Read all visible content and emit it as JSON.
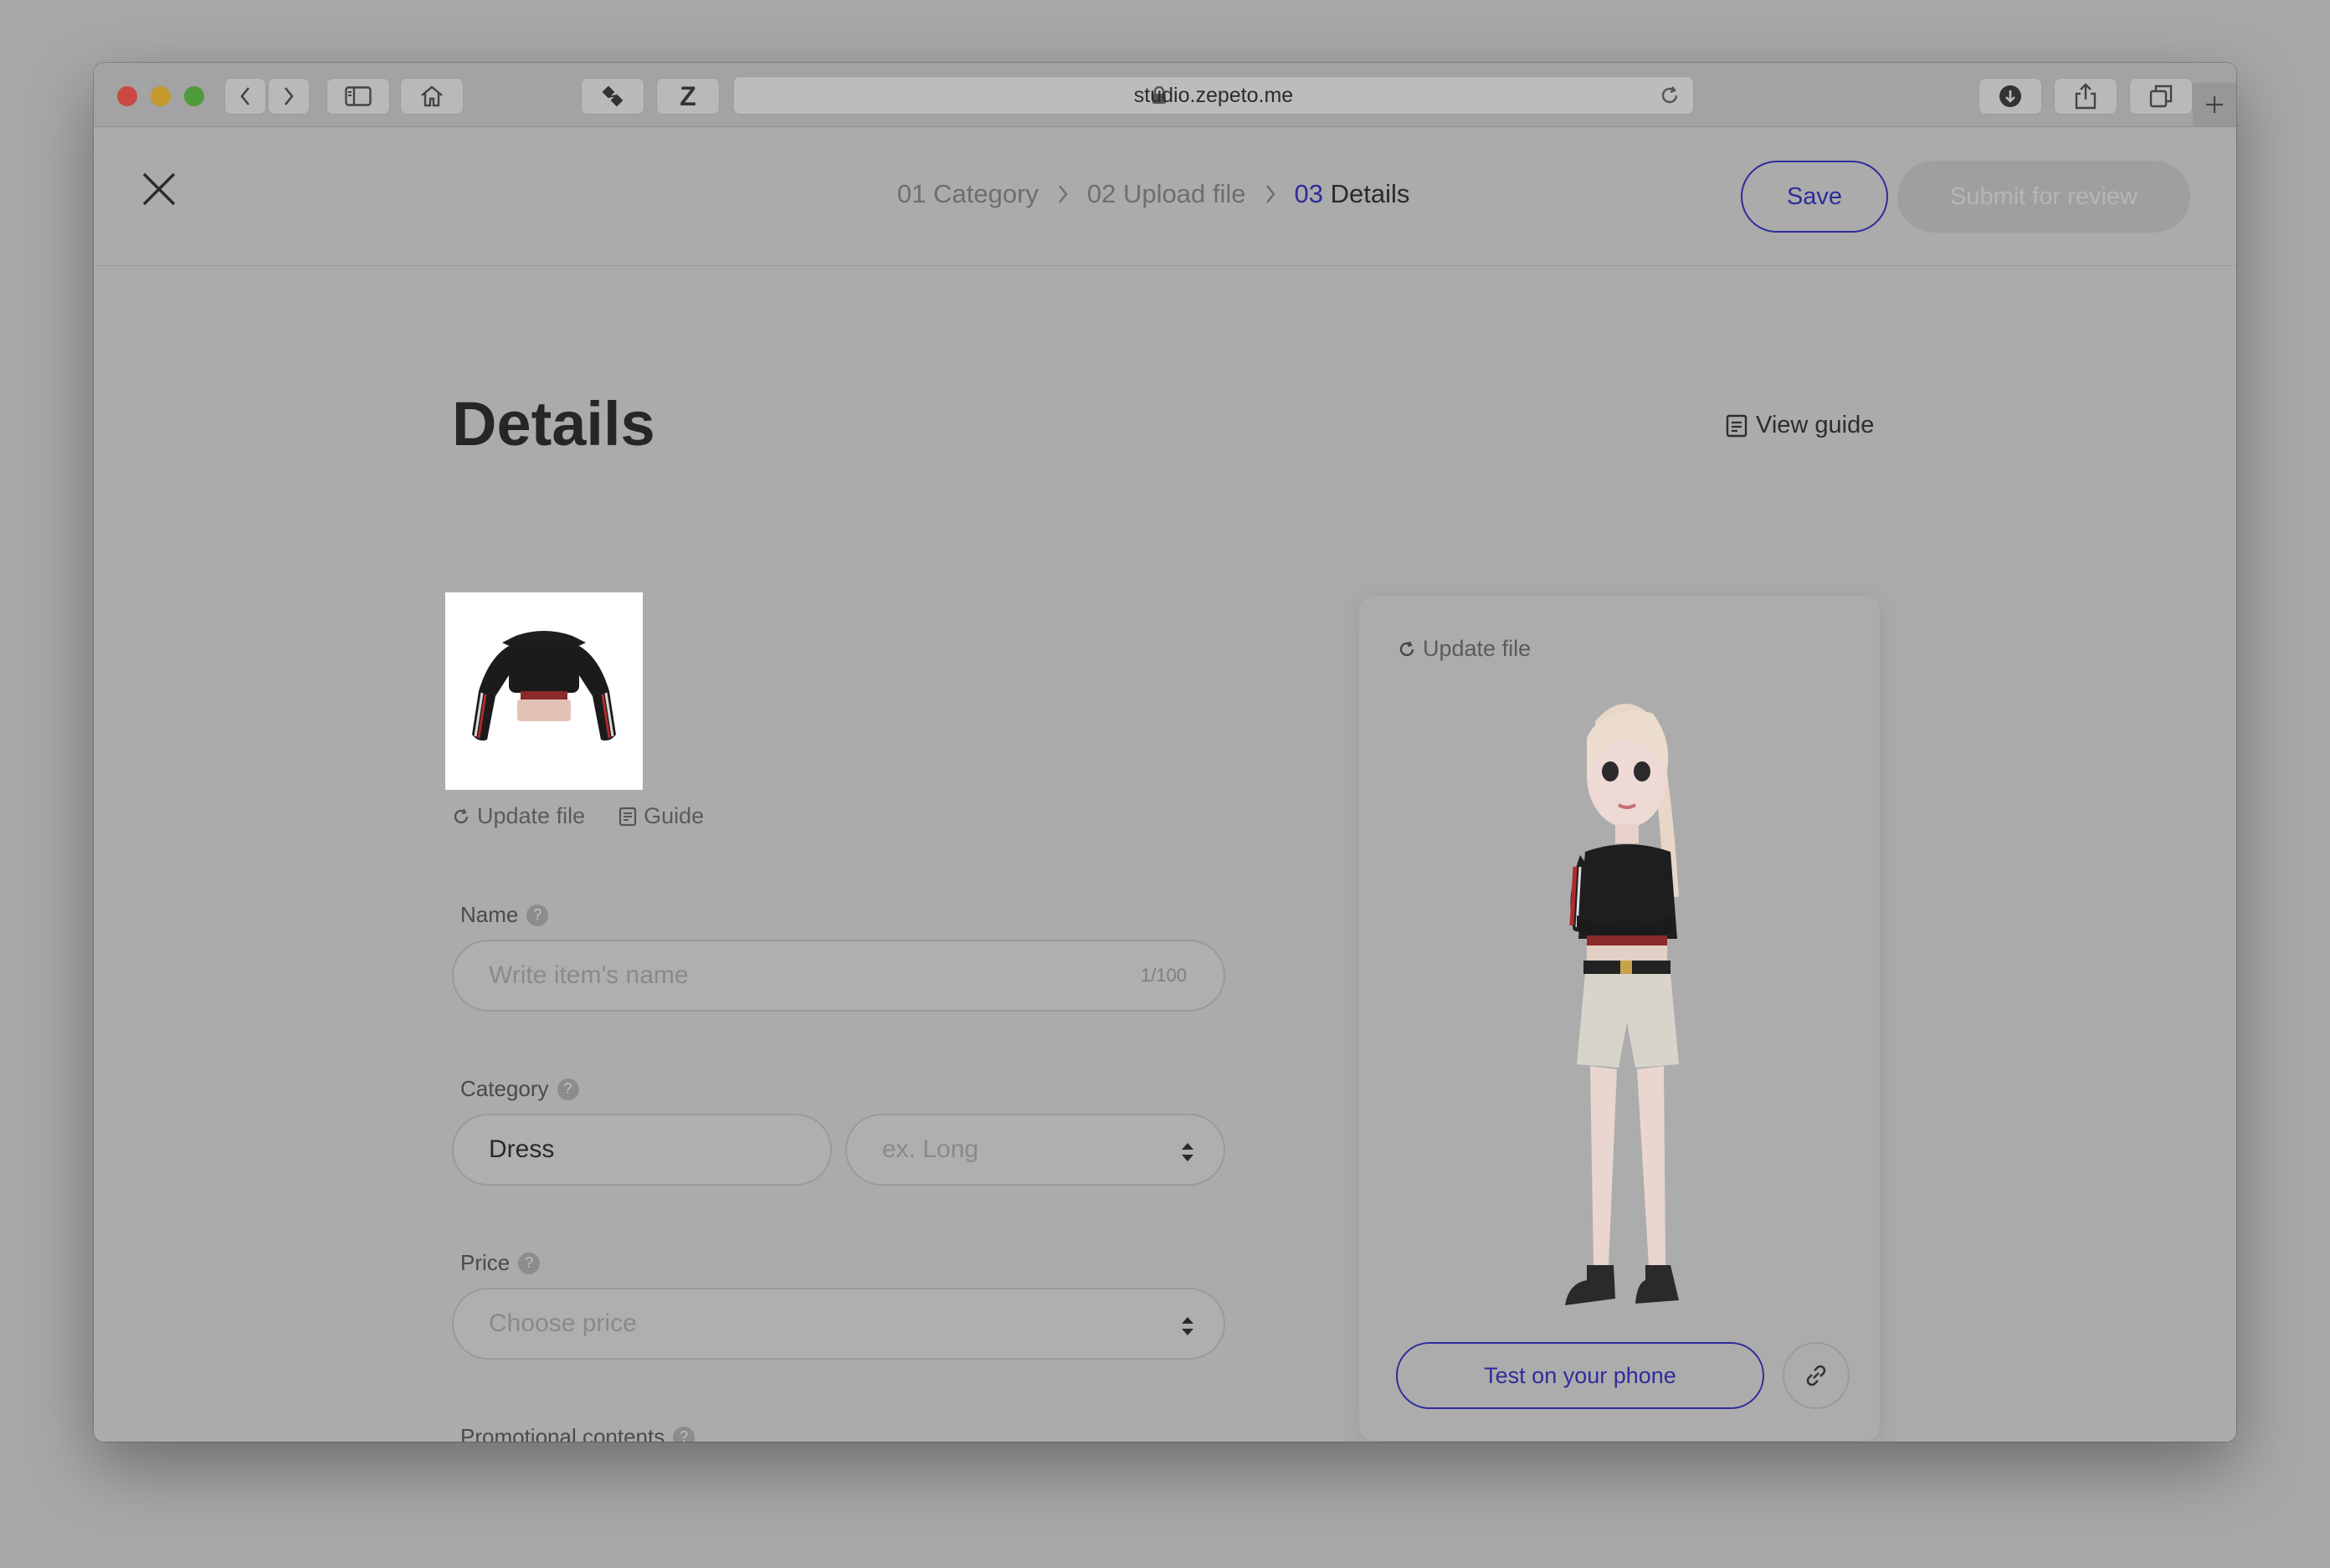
{
  "browser": {
    "url": "studio.zepeto.me",
    "extension_label": "Z"
  },
  "header": {
    "steps": [
      {
        "number": "01",
        "label": "Category"
      },
      {
        "number": "02",
        "label": "Upload file"
      },
      {
        "number": "03",
        "label": "Details"
      }
    ],
    "save_label": "Save",
    "submit_label": "Submit for review"
  },
  "main": {
    "title": "Details",
    "view_guide": "View guide",
    "update_file": "Update file",
    "guide": "Guide"
  },
  "form": {
    "name": {
      "label": "Name",
      "placeholder": "Write item's name",
      "counter": "1/100"
    },
    "category": {
      "label": "Category",
      "value": "Dress",
      "sub_placeholder": "ex. Long"
    },
    "price": {
      "label": "Price",
      "placeholder": "Choose price"
    },
    "promotional": {
      "label": "Promotional contents"
    }
  },
  "preview": {
    "update_file": "Update file",
    "test_button": "Test on your phone"
  },
  "colors": {
    "accent": "#2e2c9b",
    "overlay_bg": "#ababab"
  }
}
